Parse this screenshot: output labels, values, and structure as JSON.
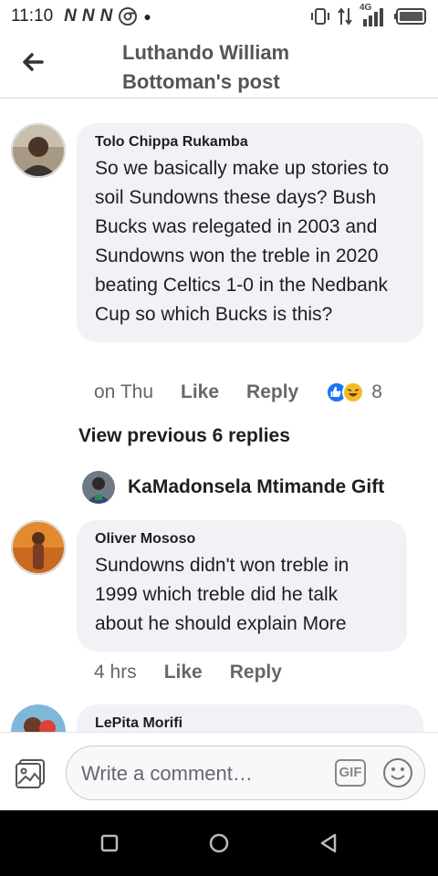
{
  "status_bar": {
    "time": "11:10",
    "network_label": "4G"
  },
  "header": {
    "title_line1": "Luthando William",
    "title_line2": "Bottoman's post"
  },
  "comments": [
    {
      "author": "Tolo Chippa Rukamba",
      "text": "So we basically make up stories to soil Sundowns these days? Bush Bucks was relegated in 2003 and Sundowns won the treble in 2020 beating Celtics 1-0 in the Nedbank Cup so which Bucks is this?",
      "time": "on Thu",
      "like_label": "Like",
      "reply_label": "Reply",
      "reaction_count": "8"
    },
    {
      "author": "Oliver Mososo",
      "text": "Sundowns didn't won treble in 1999 which treble did he talk about he should explain More",
      "time": "4 hrs",
      "like_label": "Like",
      "reply_label": "Reply"
    },
    {
      "author": "LePita Morifi"
    }
  ],
  "view_previous": "View previous 6 replies",
  "reply_author": "KaMadonsela Mtimande Gift",
  "composer": {
    "placeholder": "Write a comment…",
    "gif_label": "GIF"
  },
  "colors": {
    "accent": "#1877f2",
    "bubble": "#f0f2f5",
    "meta_text": "#65676b"
  }
}
